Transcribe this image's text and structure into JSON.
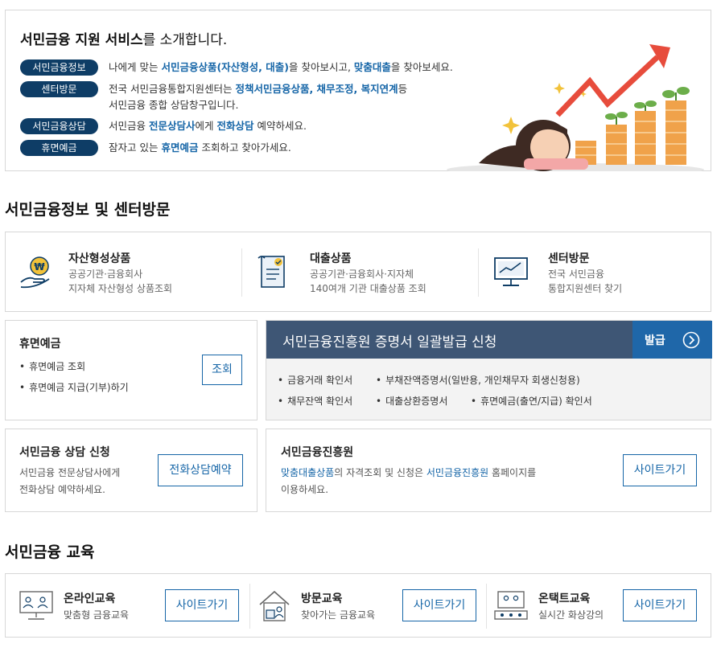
{
  "intro": {
    "title_bold": "서민금융 지원 서비스",
    "title_rest": "를 소개합니다.",
    "rows": [
      {
        "tag": "서민금융정보",
        "parts": [
          {
            "t": "나에게 맞는 ",
            "h": false
          },
          {
            "t": "서민금융상품(자산형성, 대출)",
            "h": true
          },
          {
            "t": "을 찾아보시고, ",
            "h": false
          },
          {
            "t": "맞춤대출",
            "h": true
          },
          {
            "t": "을 찾아보세요.",
            "h": false
          }
        ]
      },
      {
        "tag": "센터방문",
        "parts": [
          {
            "t": "전국 서민금융통합지원센터는 ",
            "h": false
          },
          {
            "t": "정책서민금융상품, 채무조정, 복지연계",
            "h": true
          },
          {
            "t": "등",
            "h": false
          }
        ],
        "line2": "서민금융 종합 상담창구입니다."
      },
      {
        "tag": "서민금융상담",
        "parts": [
          {
            "t": "서민금융 ",
            "h": false
          },
          {
            "t": "전문상담사",
            "h": true
          },
          {
            "t": "에게 ",
            "h": false
          },
          {
            "t": "전화상담",
            "h": true
          },
          {
            "t": " 예약하세요.",
            "h": false
          }
        ]
      },
      {
        "tag": "휴면예금",
        "parts": [
          {
            "t": "잠자고 있는 ",
            "h": false
          },
          {
            "t": "휴면예금",
            "h": true
          },
          {
            "t": " 조회하고 찾아가세요.",
            "h": false
          }
        ]
      }
    ]
  },
  "section1": {
    "title": "서민금융정보 및 센터방문"
  },
  "services": [
    {
      "title": "자산형성상품",
      "desc1": "공공기관·금융회사",
      "desc2": "지자체 자산형성 상품조회",
      "icon": "coin-hand-icon"
    },
    {
      "title": "대출상품",
      "desc1": "공공기관·금융회사·지자체",
      "desc2": "140여개 기관 대출상품 조회",
      "icon": "document-icon"
    },
    {
      "title": "센터방문",
      "desc1": "전국 서민금융",
      "desc2": "통합지원센터 찾기",
      "icon": "monitor-chart-icon"
    }
  ],
  "dormant": {
    "title": "휴면예금",
    "items": [
      "휴면예금 조회",
      "휴면예금 지급(기부)하기"
    ],
    "button": "조회"
  },
  "cert": {
    "title": "서민금융진흥원 증명서 일괄발급 신청",
    "issue": "발급",
    "row1": [
      "금융거래 확인서",
      "부채잔액증명서(일반용, 개인채무자 회생신청용)"
    ],
    "row2": [
      "채무잔액 확인서",
      "대출상환증명서",
      "휴면예금(출연/지급) 확인서"
    ]
  },
  "consult": {
    "title": "서민금융 상담 신청",
    "desc1": "서민금융 전문상담사에게",
    "desc2": "전화상담 예약하세요.",
    "button": "전화상담예약"
  },
  "kinfa": {
    "title": "서민금융진흥원",
    "desc1_link1": "맞춤대출상품",
    "desc1_mid": "의 자격조회 및 신청은 ",
    "desc1_link2": "서민금융진흥원",
    "desc1_end": " 홈페이지를",
    "desc2": "이용하세요.",
    "button": "사이트가기"
  },
  "section2": {
    "title": "서민금융 교육"
  },
  "education": [
    {
      "title": "온라인교육",
      "desc": "맞춤형 금융교육",
      "button": "사이트가기",
      "icon": "online-class-icon"
    },
    {
      "title": "방문교육",
      "desc": "찾아가는 금융교육",
      "button": "사이트가기",
      "icon": "house-visit-icon"
    },
    {
      "title": "온택트교육",
      "desc": "실시간 화상강의",
      "button": "사이트가기",
      "icon": "video-class-icon"
    }
  ],
  "colors": {
    "navy": "#0e3d66",
    "accent": "#1565a7",
    "cert_header": "#3e5675",
    "issue_button": "#1f67a9"
  }
}
